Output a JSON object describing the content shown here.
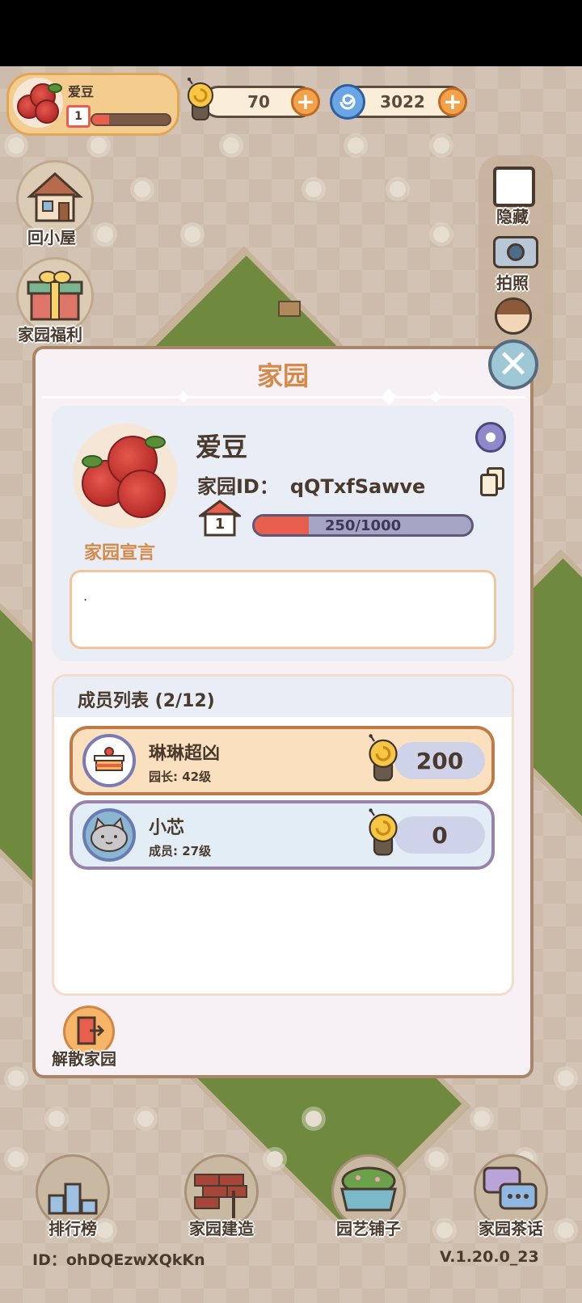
{
  "top_bar": {
    "player_name": "爱豆",
    "level": "1",
    "currencies": [
      {
        "name": "snail-coin",
        "value": "70"
      },
      {
        "name": "swirl-gem",
        "value": "3022"
      }
    ]
  },
  "side_left": [
    {
      "label": "回小屋",
      "icon": "house-icon"
    },
    {
      "label": "家园福利",
      "icon": "gift-icon"
    }
  ],
  "side_right": [
    {
      "label": "隐藏",
      "icon": "hide-icon"
    },
    {
      "label": "拍照",
      "icon": "camera-icon"
    }
  ],
  "modal": {
    "title": "家园",
    "name": "爱豆",
    "id_label": "家园ID：",
    "id_value": "qQTxfSawve",
    "level": "1",
    "xp_text": "250/1000",
    "xp_fraction": 0.25,
    "manifesto_label": "家园宣言",
    "manifesto_text": ".",
    "members_title": "成员列表 (2/12)",
    "members": [
      {
        "name": "琳琳超凶",
        "role": "园长: 42级",
        "score": "200",
        "avatar": "cake-icon"
      },
      {
        "name": "小芯",
        "role": "成员: 27级",
        "score": "0",
        "avatar": "cat-icon"
      }
    ],
    "disband_label": "解散家园"
  },
  "bottom_nav": [
    {
      "label": "排行榜",
      "icon": "podium-icon"
    },
    {
      "label": "家园建造",
      "icon": "bricks-icon"
    },
    {
      "label": "园艺铺子",
      "icon": "planter-icon"
    },
    {
      "label": "家园茶话",
      "icon": "chat-icon"
    }
  ],
  "footer": {
    "user_id": "ID：ohDQEzwXQkKn",
    "version": "V.1.20.0_23"
  },
  "colors": {
    "accent_orange": "#d68a4a",
    "xp_fill": "#e95f4e",
    "leader_card": "#fbe0bf",
    "member_card": "#e2edf6"
  }
}
